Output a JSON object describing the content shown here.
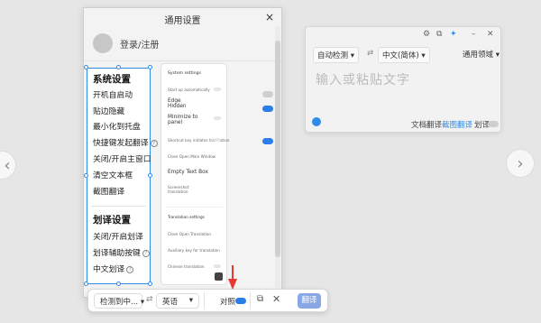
{
  "settings_window": {
    "title": "通用设置",
    "close_icon": "×",
    "login_label": "登录/注册",
    "system_section": "系统设置",
    "system_items": [
      "开机自启动",
      "贴边隐藏",
      "最小化到托盘",
      "快捷键发起翻译",
      "关闭/开启主窗口",
      "清空文本框",
      "截图翻译"
    ],
    "translate_section": "划译设置",
    "translate_items": [
      "关闭/开启划译",
      "划译辅助按键",
      "中文划译"
    ],
    "preview": {
      "system_heading": "System settings",
      "lines": [
        "Start up automatically",
        "Edge",
        "Hidden",
        "Minimize to",
        "panel",
        "Shortcut key initiates translation",
        "Close Open Main Window",
        "Empty Text Box",
        "Screenshot",
        "translation",
        "Translation settings",
        "Close Open Translation",
        "Auxiliary key for translation",
        "Chinese translation"
      ]
    }
  },
  "translate_panel": {
    "source_lang": "自动检测",
    "swap_icon": "⇄",
    "target_lang": "中文(简体)",
    "domain": "通用领域",
    "placeholder": "输入或粘贴文字",
    "footer_links": [
      "文档翻译",
      "截图翻译",
      "划译"
    ],
    "icons": [
      "settings-icon",
      "screenshot-icon",
      "pin-icon",
      "minimize-icon",
      "close-icon"
    ]
  },
  "bottom_bar": {
    "source_lang": "检测到中...",
    "swap_icon": "⇄",
    "target_lang": "英语",
    "compare_label": "对照",
    "translate_button": "翻译"
  },
  "nav": {
    "prev": "‹",
    "next": "›"
  },
  "colors": {
    "accent": "#2f8ce8",
    "button": "#88a7e6",
    "marker": "#e8372c"
  }
}
